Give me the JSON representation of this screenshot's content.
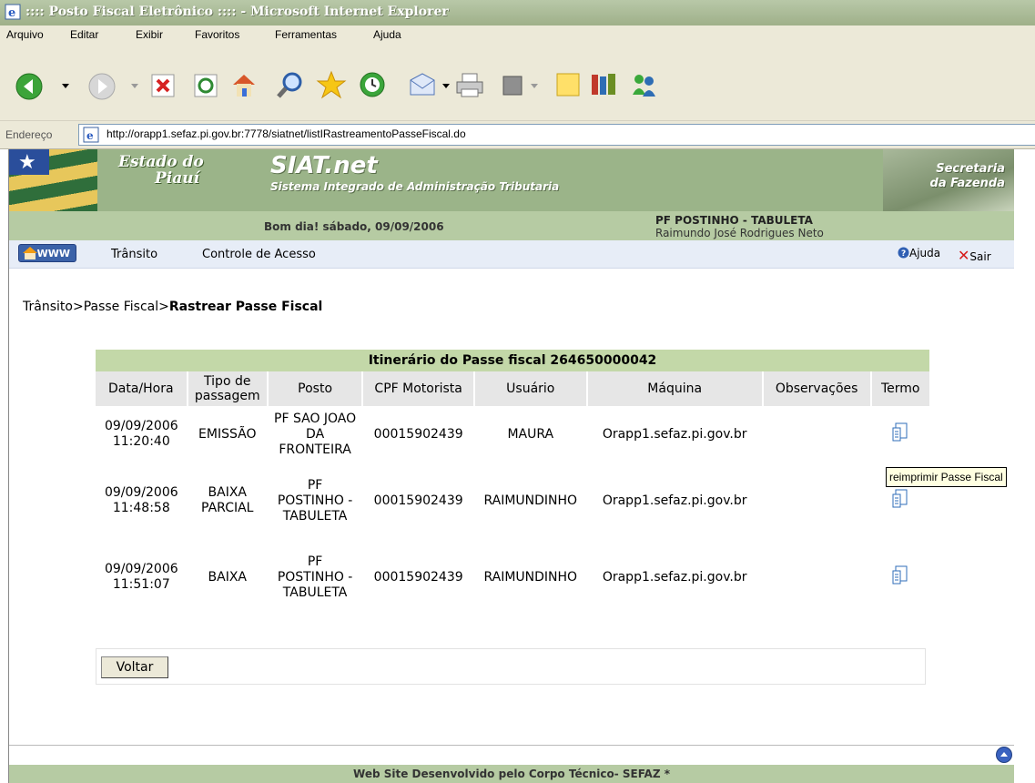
{
  "window": {
    "title": ":::: Posto Fiscal Eletrônico :::: - Microsoft Internet Explorer"
  },
  "menu": [
    "Arquivo",
    "Editar",
    "Exibir",
    "Favoritos",
    "Ferramentas",
    "Ajuda"
  ],
  "toolbar_icons": [
    "back-icon",
    "forward-icon",
    "stop-icon",
    "refresh-icon",
    "home-icon",
    "search-icon",
    "favorites-icon",
    "history-icon",
    "mail-icon",
    "print-icon",
    "edit-icon",
    "discuss-icon",
    "research-icon",
    "messenger-icon"
  ],
  "address": {
    "label": "Endereço",
    "url": "http://orapp1.sefaz.pi.gov.br:7778/siatnet/listIRastreamentoPasseFiscal.do"
  },
  "banner": {
    "estado_line1": "Estado do",
    "estado_line2": "Piauí",
    "siat_title": "SIAT.net",
    "siat_subtitle": "Sistema Integrado de Administração Tributaria",
    "secretaria_line1": "Secretaria",
    "secretaria_line2": "da Fazenda",
    "greeting": "Bom dia! sábado, 09/09/2006",
    "post": "PF POSTINHO - TABULETA",
    "user": "Raimundo José Rodrigues Neto"
  },
  "nav": {
    "www": "WWW",
    "items": [
      "Trânsito",
      "Controle de Acesso"
    ],
    "help": "Ajuda",
    "exit": "Sair"
  },
  "breadcrumb": {
    "part1": "Trânsito",
    "part2": "Passe Fiscal",
    "current": "Rastrear Passe Fiscal"
  },
  "table": {
    "title": "Itinerário do Passe fiscal 264650000042",
    "headers": [
      "Data/Hora",
      "Tipo de passagem",
      "Posto",
      "CPF Motorista",
      "Usuário",
      "Máquina",
      "Observações",
      "Termo"
    ],
    "rows": [
      {
        "date": "09/09/2006",
        "time": "11:20:40",
        "tipo": "EMISSÃO",
        "posto": "PF SAO JOAO DA FRONTEIRA",
        "cpf": "00015902439",
        "usuario": "MAURA",
        "maquina": "Orapp1.sefaz.pi.gov.br",
        "obs": ""
      },
      {
        "date": "09/09/2006",
        "time": "11:48:58",
        "tipo": "BAIXA PARCIAL",
        "posto": "PF POSTINHO - TABULETA",
        "cpf": "00015902439",
        "usuario": "RAIMUNDINHO",
        "maquina": "Orapp1.sefaz.pi.gov.br",
        "obs": ""
      },
      {
        "date": "09/09/2006",
        "time": "11:51:07",
        "tipo": "BAIXA",
        "posto": "PF POSTINHO - TABULETA",
        "cpf": "00015902439",
        "usuario": "RAIMUNDINHO",
        "maquina": "Orapp1.sefaz.pi.gov.br",
        "obs": ""
      }
    ]
  },
  "tooltip": "reimprimir Passe Fiscal",
  "button": {
    "voltar": "Voltar"
  },
  "footer": "Web Site Desenvolvido pelo Corpo Técnico- SEFAZ *"
}
